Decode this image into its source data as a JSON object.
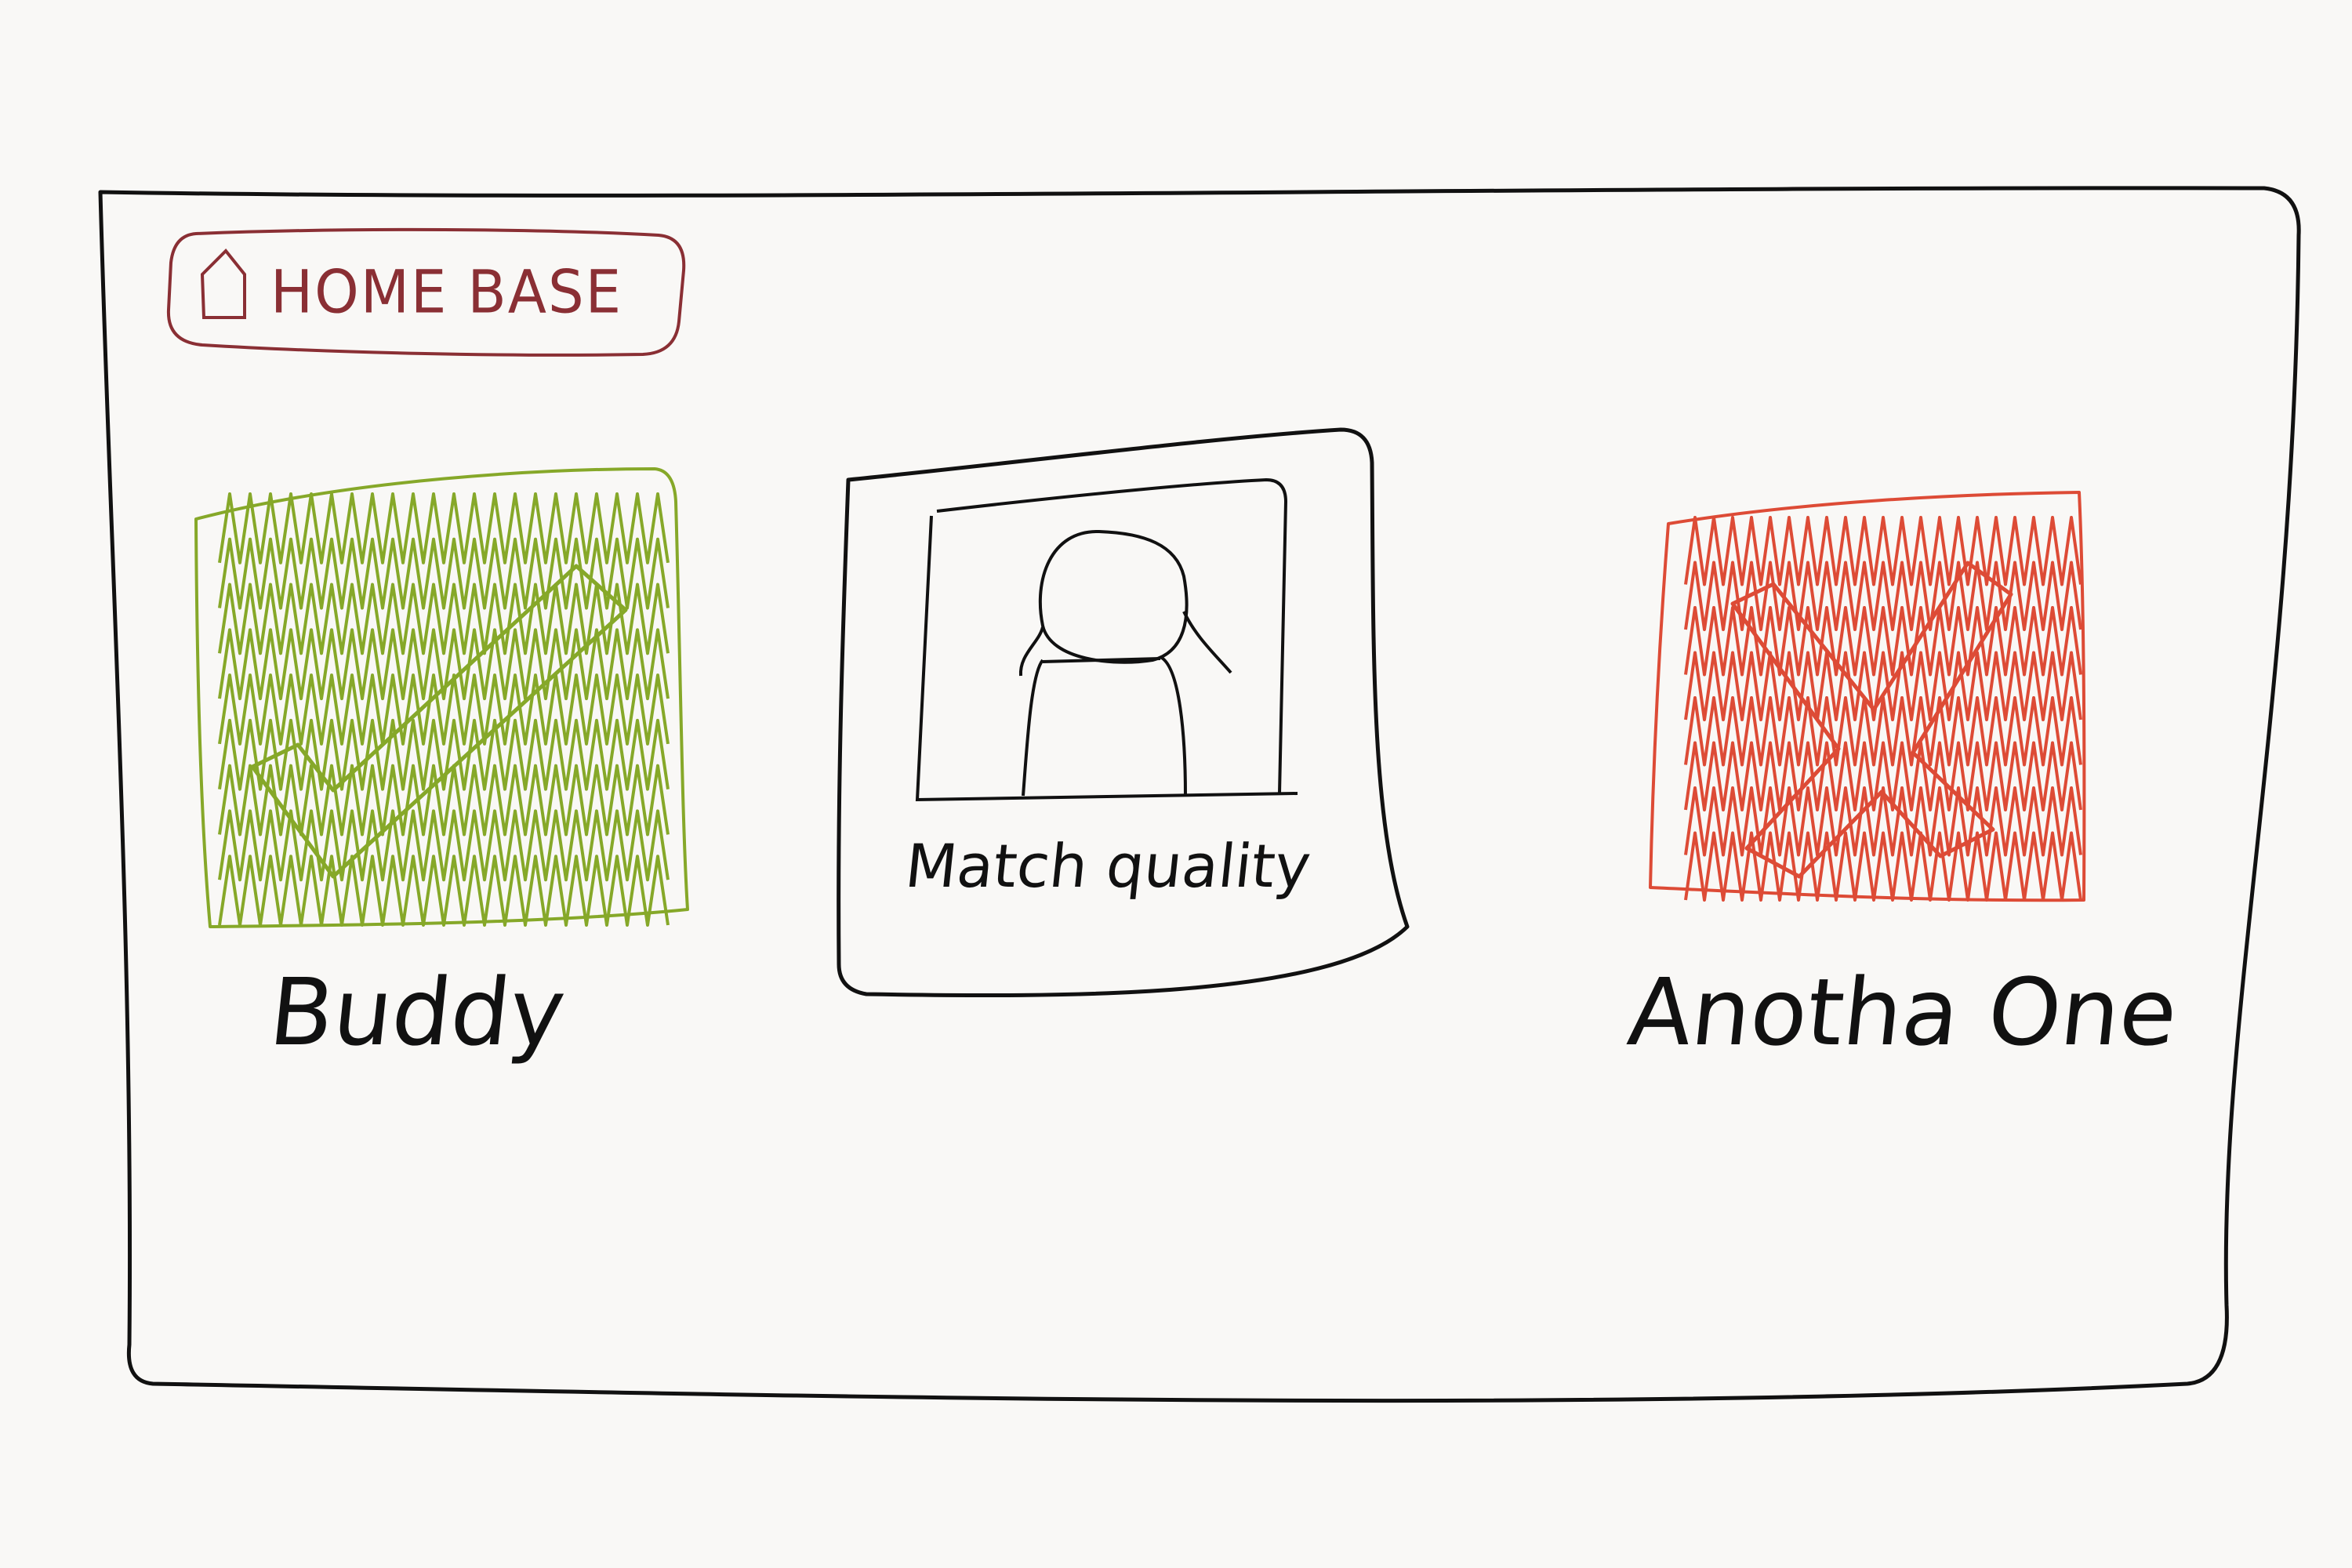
{
  "home_button": {
    "label": "HOME BASE",
    "icon": "house-icon",
    "color": "#8a2f34"
  },
  "approve_button": {
    "label": "Buddy",
    "icon": "checkmark-icon",
    "color": "#86a829"
  },
  "profile_card": {
    "caption": "Match quality",
    "icon": "person-silhouette-icon"
  },
  "reject_button": {
    "label": "Anotha One",
    "icon": "x-icon",
    "color": "#dd4b36"
  }
}
